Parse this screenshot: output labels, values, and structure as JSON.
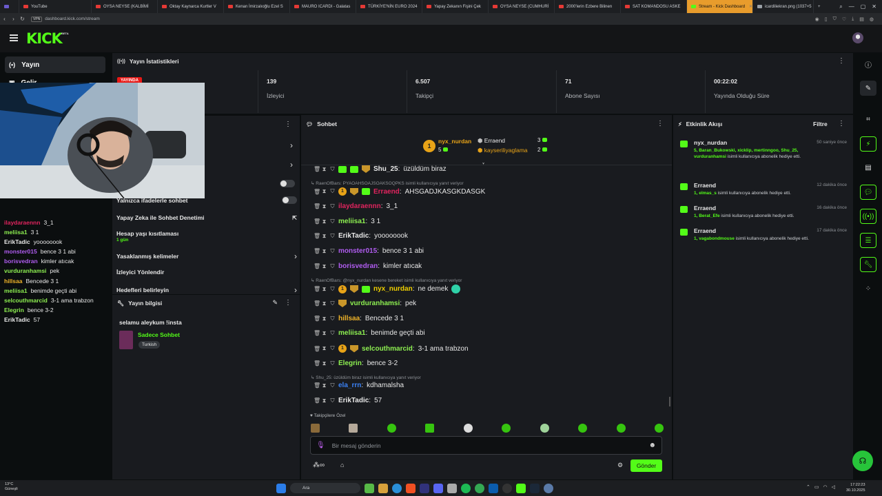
{
  "browser": {
    "tabs": [
      {
        "label": "YouTube"
      },
      {
        "label": "OYSA NEYSE (KALBİMİ"
      },
      {
        "label": "Oktay Kaynarca Kurtler V"
      },
      {
        "label": "Kenan İmirzalıoğlu Ezel S"
      },
      {
        "label": "MAURO ICARDI - Galatas"
      },
      {
        "label": "TÜRKİYE'NİN EURO 2024"
      },
      {
        "label": "Yapay Zekanın Fişini Çek"
      },
      {
        "label": "OYSA NEYSE (CUMHURİ"
      },
      {
        "label": "2000'lerin Ezbere Bilinen"
      },
      {
        "label": "SAT KOMANDOSU ASKE"
      },
      {
        "label": "Stream - Kick Dashboard"
      },
      {
        "label": "icardiliekran.png (1037×5"
      }
    ],
    "vpn_label": "VPN",
    "url": "dashboard.kick.com/stream"
  },
  "brand": {
    "logo": "KICK",
    "badge": "BETA",
    "accent": "#53fc18"
  },
  "left_nav": {
    "items": [
      {
        "label": "Yayın",
        "icon": "broadcast-icon"
      },
      {
        "label": "Gelir",
        "icon": "wallet-icon"
      }
    ]
  },
  "overlay_chat": [
    {
      "user": "ilaydaraennn",
      "color": "#e0245e",
      "text": "3_1"
    },
    {
      "user": "meliisa1",
      "color": "#8ef051",
      "text": "3 1"
    },
    {
      "user": "ErikTadic",
      "color": "#e8e8e8",
      "text": "yoooooook"
    },
    {
      "user": "monster015",
      "color": "#b05cf0",
      "text": "bence 3 1 abi"
    },
    {
      "user": "borisvedran",
      "color": "#b05cf0",
      "text": "kimler atıcak"
    },
    {
      "user": "vurduranhamsi",
      "color": "#8ef051",
      "text": "pek"
    },
    {
      "user": "hillsaa",
      "color": "#f0b429",
      "text": "Bencede 3 1"
    },
    {
      "user": "meliisa1",
      "color": "#8ef051",
      "text": "benimde geçti abi"
    },
    {
      "user": "selcouthmarcid",
      "color": "#8ef051",
      "text": "3-1 ama trabzon"
    },
    {
      "user": "Elegrin",
      "color": "#8ef051",
      "text": "bence 3-2"
    },
    {
      "user": "ErikTadic",
      "color": "#e8e8e8",
      "text": "57"
    }
  ],
  "stats": {
    "title": "Yayın İstatistikleri",
    "live_badge": "YAYINDA",
    "items": [
      {
        "value": "139",
        "label": "İzleyici"
      },
      {
        "value": "6.507",
        "label": "Takipçi"
      },
      {
        "value": "71",
        "label": "Abone Sayısı"
      },
      {
        "value": "00:22:02",
        "label": "Yayında Olduğu Süre"
      }
    ]
  },
  "settings": {
    "rows": [
      {
        "label": "Yalnızca ifadelerle sohbet"
      },
      {
        "label": "Yapay Zeka ile Sohbet Denetimi"
      },
      {
        "label": "Hesap yaşı kısıtlaması",
        "sub": "1 gün"
      },
      {
        "label": "Yasaklanmış kelimeler"
      },
      {
        "label": "İzleyici Yönlendir"
      },
      {
        "label": "Hedefleri belirleyin"
      }
    ]
  },
  "stream_info": {
    "title": "Yayın bilgisi",
    "stream_title": "selamu aleykum !insta",
    "category": "Sadece Sohbet",
    "tag": "Turkish"
  },
  "chat": {
    "title": "Sohbet",
    "leaderboard": {
      "first": {
        "name": "nyx_nurdan",
        "count": "5"
      },
      "second": {
        "name": "Erraend",
        "count": "3"
      },
      "third": {
        "name": "kayseriliyaglama",
        "count": "2"
      }
    },
    "messages": [
      {
        "type": "msg",
        "user": "Shu_25",
        "color": "#e8e8e8",
        "text": "üzüldüm biraz"
      },
      {
        "type": "reply",
        "text": "RaenOfBars: PYAOAHSOAJSOAKSOQPKS isimli kullanıcıya yanıt veriyor"
      },
      {
        "type": "msg",
        "user": "Erraend",
        "color": "#e0245e",
        "text": "AHSGADJKASGKDASGK"
      },
      {
        "type": "msg",
        "user": "ilaydaraennn",
        "color": "#e0245e",
        "text": "3_1"
      },
      {
        "type": "msg",
        "user": "meliisa1",
        "color": "#8ef051",
        "text": "3 1"
      },
      {
        "type": "msg",
        "user": "ErikTadic",
        "color": "#e8e8e8",
        "text": "yoooooook"
      },
      {
        "type": "msg",
        "user": "monster015",
        "color": "#b05cf0",
        "text": "bence 3 1 abi"
      },
      {
        "type": "msg",
        "user": "borisvedran",
        "color": "#b05cf0",
        "text": "kimler atıcak"
      },
      {
        "type": "reply",
        "text": "RaenOfBars: @nyx_nurdan kesene bereket isimli kullanıcıya yanıt veriyor"
      },
      {
        "type": "msg",
        "user": "nyx_nurdan",
        "color": "#f0d000",
        "text": "ne demek"
      },
      {
        "type": "msg",
        "user": "vurduranhamsi",
        "color": "#8ef051",
        "text": "pek"
      },
      {
        "type": "msg",
        "user": "hillsaa",
        "color": "#f0b429",
        "text": "Bencede 3 1"
      },
      {
        "type": "msg",
        "user": "meliisa1",
        "color": "#8ef051",
        "text": "benimde geçti abi"
      },
      {
        "type": "msg",
        "user": "selcouthmarcid",
        "color": "#8ef051",
        "text": "3-1 ama trabzon"
      },
      {
        "type": "msg",
        "user": "Elegrin",
        "color": "#8ef051",
        "text": "bence 3-2"
      },
      {
        "type": "reply",
        "text": "Shu_25: üzüldüm biraz isimli kullanıcıya yanıt veriyor"
      },
      {
        "type": "msg",
        "user": "ela_rrn",
        "color": "#3b82f6",
        "text": "kdhamalsha"
      },
      {
        "type": "msg",
        "user": "ErikTadic",
        "color": "#e8e8e8",
        "text": "57"
      }
    ],
    "followers_only_label": "Takipçilere Özel",
    "input_placeholder": "Bir mesaj gönderin",
    "send_label": "Gönder"
  },
  "feed": {
    "title": "Etkinlik Akışı",
    "filter_label": "Filtre",
    "items": [
      {
        "name": "nyx_nurdan",
        "time": "50 saniye önce",
        "highlight": "5, Baran_Bukowski, xicklip, mertinngoo, Shu_25, vurduranhamsi",
        "text": "isimli kullanıcıya abonelik hediye etti."
      },
      {
        "name": "Erraend",
        "time": "12 dakika önce",
        "highlight": "1, elmas_s",
        "text": "isimli kullanıcıya abonelik hediye etti."
      },
      {
        "name": "Erraend",
        "time": "16 dakika önce",
        "highlight": "1, Berat_Efe",
        "text": "isimli kullanıcıya abonelik hediye etti."
      },
      {
        "name": "Erraend",
        "time": "17 dakika önce",
        "highlight": "1, vagabondmouse",
        "text": "isimli kullanıcıya abonelik hediye etti."
      }
    ]
  },
  "taskbar": {
    "weather_temp": "13°C",
    "weather_desc": "Güneşli",
    "search_label": "Ara",
    "time": "17:22:23",
    "date": "30.10.2025"
  }
}
